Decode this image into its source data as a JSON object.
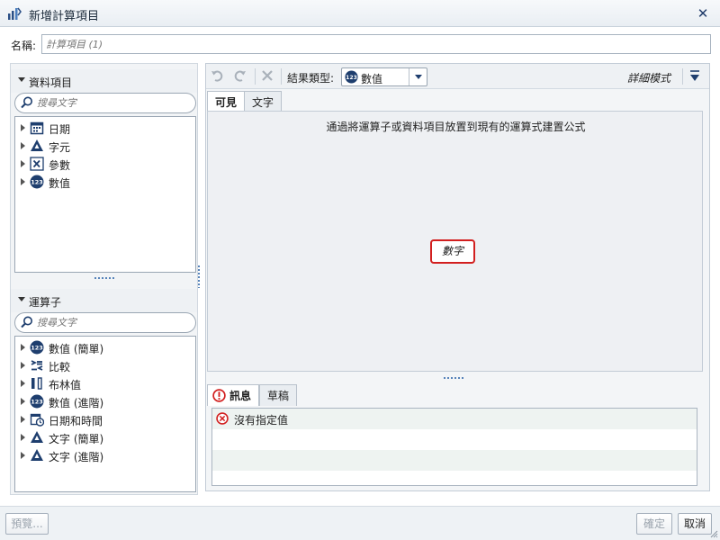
{
  "window": {
    "title": "新增計算項目"
  },
  "name_field": {
    "label": "名稱:",
    "placeholder": "計算項目 (1)"
  },
  "left": {
    "data_items": {
      "header": "資料項目",
      "search_placeholder": "搜尋文字",
      "items": [
        {
          "label": "日期",
          "icon": "calendar-icon"
        },
        {
          "label": "字元",
          "icon": "character-icon"
        },
        {
          "label": "參數",
          "icon": "parameter-icon"
        },
        {
          "label": "數值",
          "icon": "numeric-icon"
        }
      ]
    },
    "operators": {
      "header": "運算子",
      "search_placeholder": "搜尋文字",
      "items": [
        {
          "label": "數值 (簡單)",
          "icon": "numeric-icon"
        },
        {
          "label": "比較",
          "icon": "compare-icon"
        },
        {
          "label": "布林值",
          "icon": "boolean-icon"
        },
        {
          "label": "數值 (進階)",
          "icon": "numeric-icon"
        },
        {
          "label": "日期和時間",
          "icon": "datetime-icon"
        },
        {
          "label": "文字 (簡單)",
          "icon": "character-icon"
        },
        {
          "label": "文字 (進階)",
          "icon": "character-icon"
        }
      ]
    }
  },
  "toolbar": {
    "undo_icon": "undo-icon",
    "redo_icon": "redo-icon",
    "delete_icon": "delete-icon",
    "result_type_label": "結果類型:",
    "result_type_value": "數值",
    "detail_mode": "詳細模式"
  },
  "editor_tabs": [
    "可見",
    "文字"
  ],
  "canvas": {
    "hint": "通過將運算子或資料項目放置到現有的運算式建置公式",
    "placeholder": "數字"
  },
  "message_tabs": [
    "訊息",
    "草稿"
  ],
  "messages": [
    "沒有指定值"
  ],
  "footer": {
    "preview": "預覽...",
    "ok": "確定",
    "cancel": "取消"
  },
  "colors": {
    "accent": "#1e3e6e",
    "error": "#d21f1f",
    "icon_blue": "#2a4f86"
  }
}
